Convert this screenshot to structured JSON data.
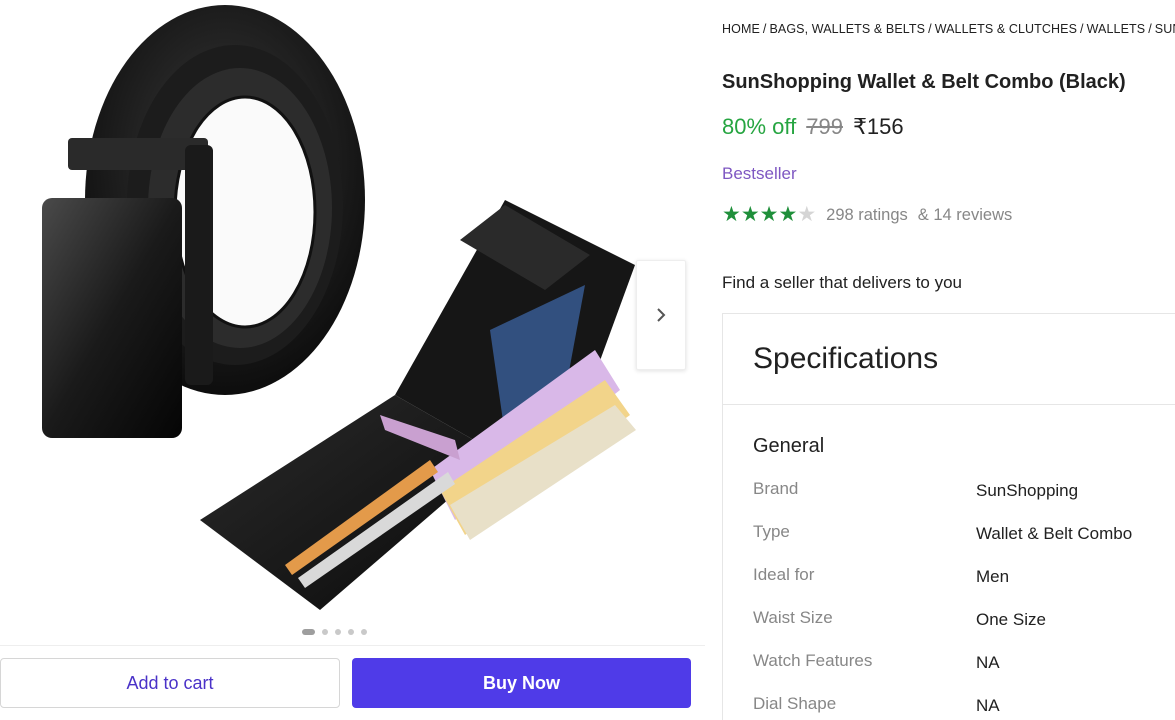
{
  "gallery": {
    "image_alt": "SunShopping Wallet & Belt Combo (Black)",
    "next_icon": "chevron-right-icon",
    "dots_count": 5,
    "active_dot": 0
  },
  "actions": {
    "add_to_cart": "Add to cart",
    "buy_now": "Buy Now"
  },
  "breadcrumb": [
    "HOME",
    "BAGS, WALLETS & BELTS",
    "WALLETS & CLUTCHES",
    "WALLETS",
    "SUN"
  ],
  "product": {
    "title": "SunShopping Wallet & Belt Combo (Black)",
    "discount": "80% off",
    "mrp": "799",
    "price": "₹156",
    "badge": "Bestseller",
    "rating": 3.8,
    "ratings_text": "298 ratings",
    "reviews_text": "& 14 reviews"
  },
  "seller_prompt": "Find a seller that delivers to you",
  "specifications": {
    "title": "Specifications",
    "section": "General",
    "rows": [
      {
        "key": "Brand",
        "value": "SunShopping"
      },
      {
        "key": "Type",
        "value": "Wallet & Belt Combo"
      },
      {
        "key": "Ideal for",
        "value": "Men"
      },
      {
        "key": "Waist Size",
        "value": "One Size"
      },
      {
        "key": "Watch Features",
        "value": "NA"
      },
      {
        "key": "Dial Shape",
        "value": "NA"
      }
    ]
  },
  "colors": {
    "discount": "#26a541",
    "brand_accent": "#4f3be8",
    "badge": "#7e57c2",
    "star": "#1f8f3a"
  }
}
